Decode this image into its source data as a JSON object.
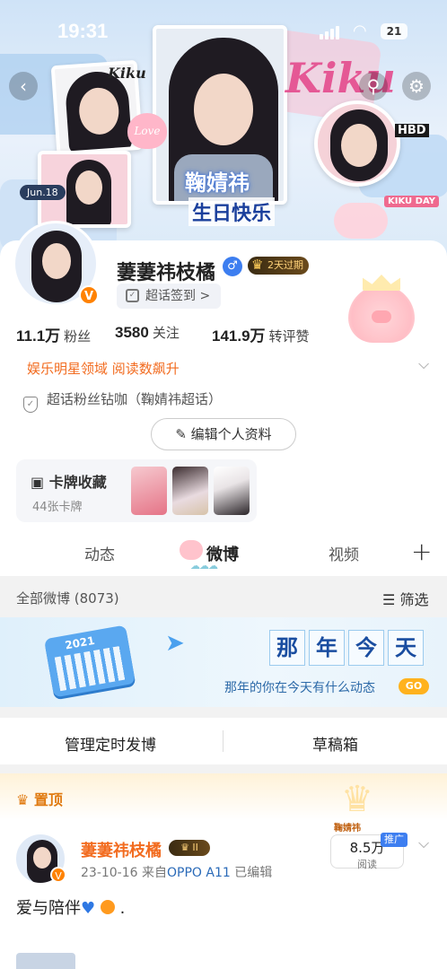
{
  "status_bar": {
    "time": "19:31",
    "battery": "21"
  },
  "banner": {
    "title_line1": "鞠婧祎",
    "title_line2": "生日快乐",
    "script_text": "Kiku",
    "date_tag": "Jun.18",
    "love_tag": "Love",
    "hbd_tag": "HBD",
    "day_tag": "KIKU DAY"
  },
  "profile": {
    "username": "萋萋祎枝橘",
    "vip_label": "2天过期",
    "checkin_label": "超话签到 >",
    "verified_badge": "V",
    "stats": [
      {
        "value": "11.1万",
        "label": "粉丝"
      },
      {
        "value": "3580",
        "label": "关注"
      },
      {
        "value": "141.9万",
        "label": "转评赞"
      }
    ],
    "honor_text": "娱乐明星领域 阅读数飙升",
    "fan_title": "超话粉丝钻咖（鞠婧祎超话）",
    "edit_button": "编辑个人资料",
    "cards": {
      "title": "卡牌收藏",
      "count": "44张卡牌"
    }
  },
  "tabs": [
    {
      "label": "动态",
      "active": false
    },
    {
      "label": "微博",
      "active": true
    },
    {
      "label": "视频",
      "active": false
    }
  ],
  "tab_plus": "+",
  "filter_bar": {
    "all_label": "全部微博 (8073)",
    "filter_label": "筛选"
  },
  "memory": {
    "chars": [
      "那",
      "年",
      "今",
      "天"
    ],
    "subtitle": "那年的你在今天有什么动态",
    "go": "GO",
    "calendar_year": "2021"
  },
  "manage": {
    "schedule": "管理定时发博",
    "drafts": "草稿箱"
  },
  "post": {
    "pinned_label": "置顶",
    "author": "萋萋祎枝橘",
    "vip_level": "II",
    "date": "23-10-16",
    "source_prefix": "来自",
    "source": "OPPO A11",
    "edited": "已编辑",
    "reads_value": "8.5万",
    "reads_label": "阅读",
    "promo": "推广",
    "corner_tag": "鞠婧祎",
    "text": "爱与陪伴"
  },
  "colors": {
    "accent": "#ff8200",
    "honor": "#f26b1f",
    "link": "#2a6ab8",
    "brand_blue": "#3d7ef0"
  }
}
